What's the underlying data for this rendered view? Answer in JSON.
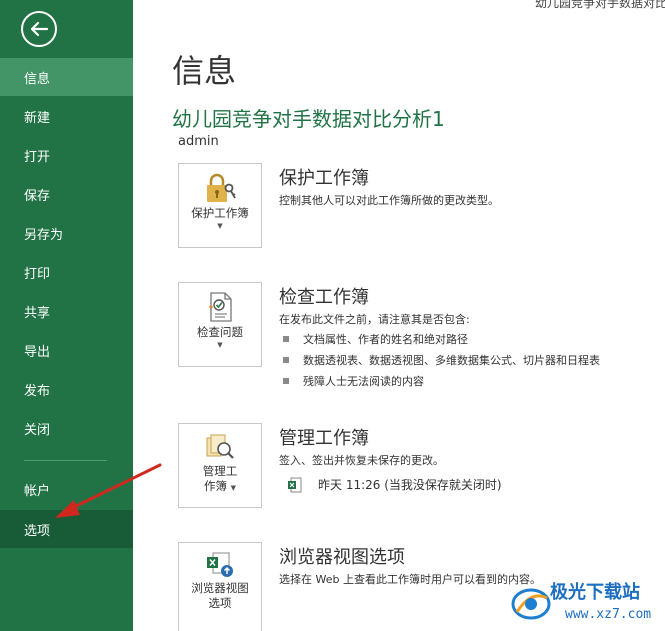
{
  "window": {
    "title": "幼儿园竞争对手数据对比分"
  },
  "sidebar": {
    "items": [
      {
        "label": "信息"
      },
      {
        "label": "新建"
      },
      {
        "label": "打开"
      },
      {
        "label": "保存"
      },
      {
        "label": "另存为"
      },
      {
        "label": "打印"
      },
      {
        "label": "共享"
      },
      {
        "label": "导出"
      },
      {
        "label": "发布"
      },
      {
        "label": "关闭"
      },
      {
        "label": "帐户"
      },
      {
        "label": "选项"
      }
    ]
  },
  "main": {
    "page_title": "信息",
    "doc_title": "幼儿园竞争对手数据对比分析1",
    "author": "admin",
    "protect": {
      "button_label": "保护工作簿",
      "title": "保护工作簿",
      "desc": "控制其他人可以对此工作簿所做的更改类型。"
    },
    "inspect": {
      "button_label": "检查问题",
      "title": "检查工作簿",
      "desc": "在发布此文件之前，请注意其是否包含:",
      "bullets": [
        "文档属性、作者的姓名和绝对路径",
        "数据透视表、数据透视图、多维数据集公式、切片器和日程表",
        "残障人士无法阅读的内容"
      ]
    },
    "manage": {
      "button_label_1": "管理工",
      "button_label_2": "作簿",
      "title": "管理工作簿",
      "desc": "签入、签出并恢复未保存的更改。",
      "version": "昨天 11:26 (当我没保存就关闭时)"
    },
    "browser": {
      "button_label_1": "浏览器视图",
      "button_label_2": "选项",
      "title": "浏览器视图选项",
      "desc": "选择在 Web 上查看此工作簿时用户可以看到的内容。"
    }
  },
  "watermark": {
    "text": "极光下载站",
    "url": "www.xz7.com"
  },
  "colors": {
    "sidebar": "#217346",
    "active": "#439467",
    "options_bg": "#185c37",
    "arrow": "#d0281e"
  }
}
